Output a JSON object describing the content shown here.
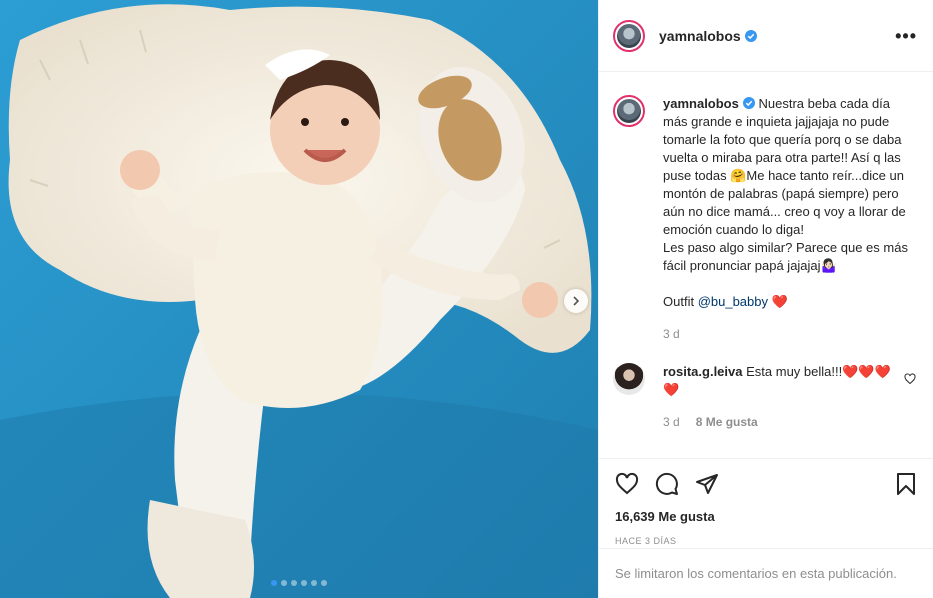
{
  "header": {
    "username": "yamnalobos",
    "verified": true,
    "more_label": "•••"
  },
  "caption": {
    "username": "yamnalobos",
    "text": "Nuestra beba cada día más grande e inquieta jajjajaja no pude tomarle la foto que quería porq o se daba vuelta o miraba para otra parte!! Así q las puse todas 🤗Me hace tanto reír...dice un montón de palabras (papá siempre) pero aún no dice mamá... creo q voy a llorar de emoción cuando lo diga!\nLes paso algo similar? Parece que es más fácil pronunciar papá jajajaj🤷🏻‍♀️\n\nOutfit ",
    "mention": "@bu_babby",
    "heart": "❤️",
    "time": "3 d"
  },
  "comments": [
    {
      "username": "rosita.g.leiva",
      "text": "Esta muy bella!!!❤️❤️❤️❤️",
      "time": "3 d",
      "likes": "8 Me gusta"
    }
  ],
  "actions": {
    "icons": [
      "heart-icon",
      "comment-icon",
      "share-icon",
      "bookmark-icon"
    ],
    "likes": "16,639 Me gusta",
    "timestamp": "HACE 3 DÍAS"
  },
  "footer": {
    "comments_limited": "Se limitaron los comentarios en esta publicación."
  },
  "carousel": {
    "slide_count": 6,
    "active_index": 0
  },
  "colors": {
    "accent": "#3897f0",
    "red_heart": "#ed4956",
    "muted": "#8e8e8e",
    "couch_blue": "#2a95c8"
  }
}
